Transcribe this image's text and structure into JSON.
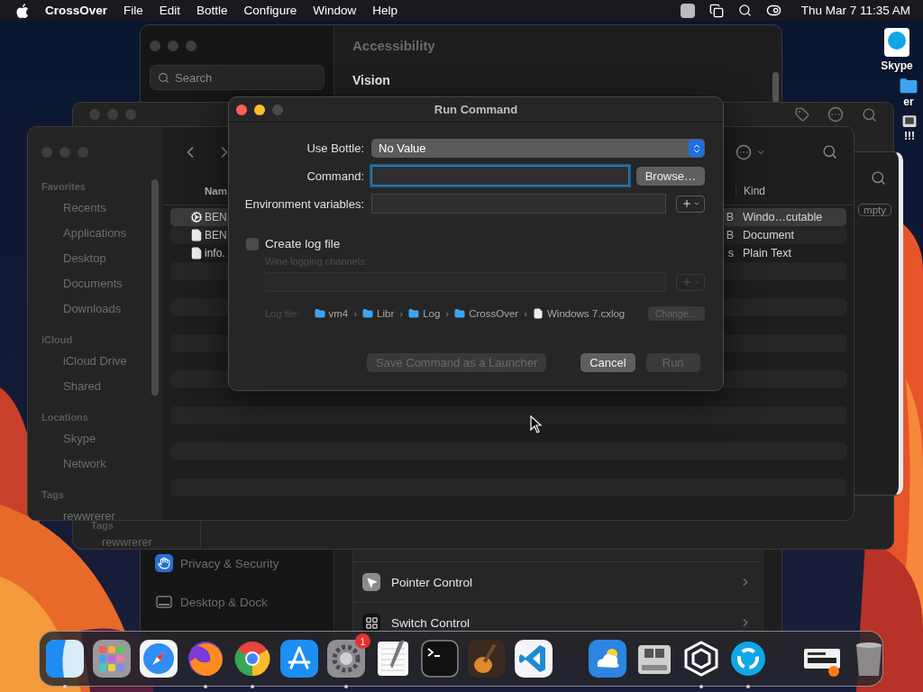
{
  "menu_bar": {
    "app_name": "CrossOver",
    "menus": [
      "File",
      "Edit",
      "Bottle",
      "Configure",
      "Window",
      "Help"
    ],
    "clock": "Thu Mar 7  11:35 AM"
  },
  "desktop_icons": [
    {
      "label": "Skype",
      "kind": "app"
    },
    {
      "label": "er",
      "kind": "folder"
    },
    {
      "label": "!!!",
      "kind": "disk"
    }
  ],
  "settings_window": {
    "search": {
      "placeholder": "Search"
    },
    "sidebar_items": [
      {
        "label": "Privacy & Security",
        "kind": "privacy"
      },
      {
        "label": "Desktop & Dock",
        "kind": "dock"
      }
    ],
    "title": "Accessibility",
    "section": "Vision",
    "rows": [
      {
        "label": "Pointer Control",
        "kind": "pointer"
      },
      {
        "label": "Switch Control",
        "kind": "switch"
      }
    ]
  },
  "back_finder": {
    "tags_heading": "Tags",
    "tag": "rewwrerer"
  },
  "side_window": {
    "tag_field": "mpty"
  },
  "finder": {
    "sidebar": [
      {
        "heading": "Favorites",
        "items": [
          "Recents",
          "Applications",
          "Desktop",
          "Documents",
          "Downloads"
        ]
      },
      {
        "heading": "iCloud",
        "items": [
          "iCloud Drive",
          "Shared"
        ]
      },
      {
        "heading": "Locations",
        "items": [
          "Skype",
          "Network"
        ]
      },
      {
        "heading": "Tags",
        "items": [
          "rewwrerer"
        ]
      }
    ],
    "columns": {
      "name": "Nam",
      "kind": "Kind"
    },
    "rows": [
      {
        "name": "BEN",
        "size": "B",
        "kind_label": "Windo…cutable",
        "kind": "executable",
        "selected": true
      },
      {
        "name": "BEN",
        "size": "B",
        "kind_label": "Document",
        "kind": "document",
        "selected": false
      },
      {
        "name": "info.",
        "size": "s",
        "kind_label": "Plain Text",
        "kind": "document",
        "selected": false
      }
    ]
  },
  "dialog": {
    "title": "Run Command",
    "bottle": {
      "label": "Use Bottle:",
      "value": "No Value"
    },
    "command": {
      "label": "Command:",
      "focused": true
    },
    "browse": "Browse…",
    "env": {
      "label": "Environment variables:"
    },
    "log_checkbox": {
      "label": "Create log file",
      "checked": false
    },
    "channels": {
      "label": "Wine logging channels:",
      "disabled": true
    },
    "log_file": {
      "label": "Log file:",
      "separator": "›",
      "path": [
        {
          "label": "vm4",
          "kind": "folder"
        },
        {
          "label": "Libr",
          "kind": "folder"
        },
        {
          "label": "Log",
          "kind": "folder"
        },
        {
          "label": "CrossOver",
          "kind": "folder"
        },
        {
          "label": "Windows 7.cxlog",
          "kind": "file"
        }
      ],
      "change": {
        "label": "Change…",
        "disabled": true
      }
    },
    "buttons": [
      {
        "label": "Save Command as a Launcher",
        "disabled": true
      },
      {
        "label": "Cancel",
        "disabled": false
      },
      {
        "label": "Run",
        "disabled": true
      }
    ]
  },
  "dock": {
    "groups": [
      [
        {
          "running": true
        },
        {
          "running": false
        },
        {
          "running": false
        },
        {
          "running": true
        },
        {
          "running": true
        },
        {
          "running": false
        },
        {
          "running": true,
          "badge": "1"
        },
        {
          "running": false
        },
        {
          "running": false
        },
        {
          "running": false
        },
        {
          "running": false
        }
      ],
      [
        {
          "running": false
        },
        {
          "running": false
        },
        {
          "running": true
        },
        {
          "running": true
        }
      ],
      [
        {
          "running": false
        },
        {
          "running": false
        }
      ]
    ]
  }
}
